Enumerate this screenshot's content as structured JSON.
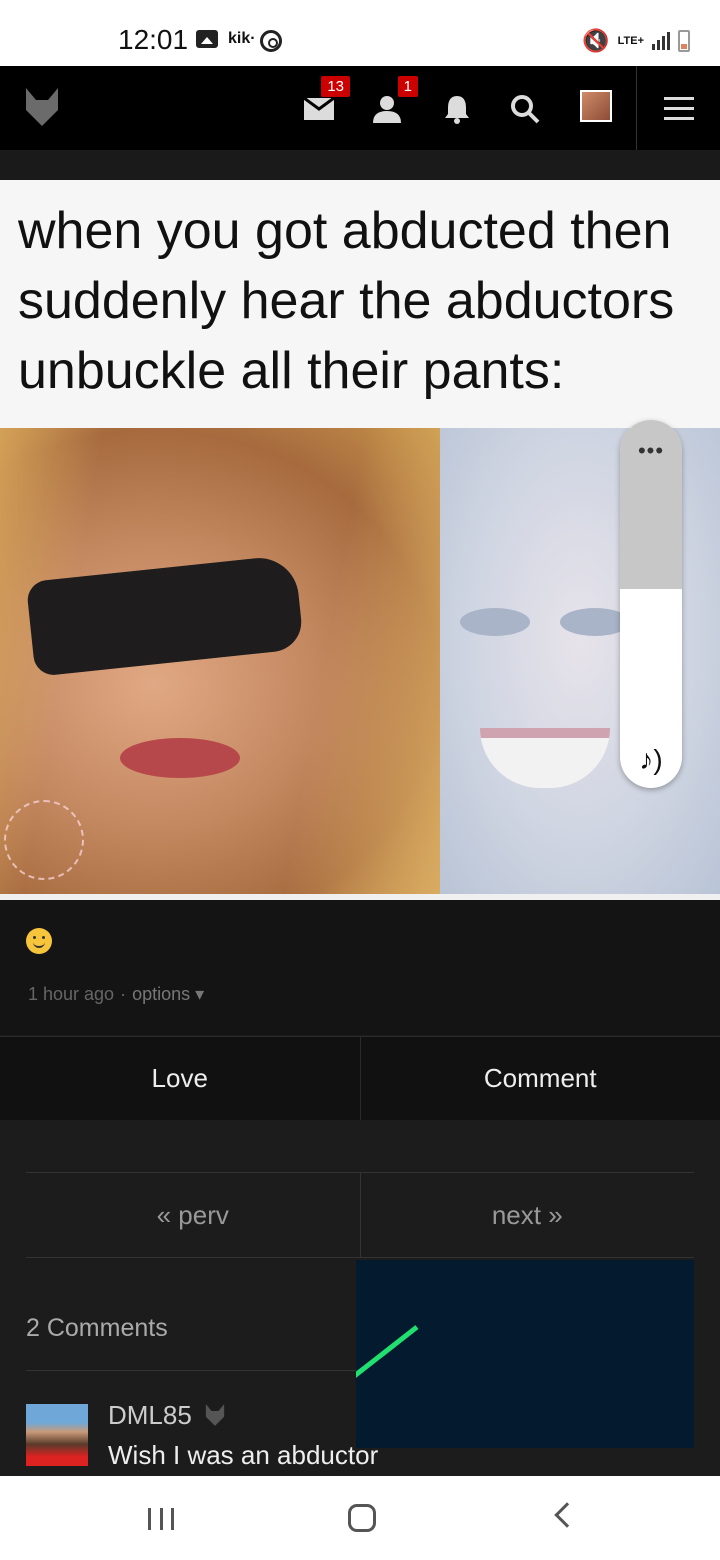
{
  "status_bar": {
    "time": "12:01",
    "kik_label": "kik·",
    "network_label": "LTE+"
  },
  "top_nav": {
    "messages_badge": "13",
    "friends_badge": "1",
    "icons": [
      "fox-logo-icon",
      "mail-icon",
      "user-icon",
      "bell-icon",
      "search-icon",
      "avatar",
      "menu-icon"
    ]
  },
  "post": {
    "caption": "when you got abducted then suddenly hear the abductors unbuckle all their pants:",
    "emoji": "slightly-smiling-face",
    "time_ago": "1 hour ago",
    "separator": "·",
    "options_label": "options ▾"
  },
  "volume_overlay": {
    "menu_dots": "•••",
    "level": 0.54
  },
  "actions": {
    "love_label": "Love",
    "comment_label": "Comment"
  },
  "pager": {
    "prev_label": "« perv",
    "next_label": "next »"
  },
  "comments": {
    "count_label": "2 Comments",
    "items": [
      {
        "user": "DML85",
        "text": "Wish I was an abductor"
      }
    ]
  },
  "colors": {
    "badge_red": "#cc0000",
    "overlay_bg": "#041a2e",
    "overlay_line": "#20e070"
  }
}
